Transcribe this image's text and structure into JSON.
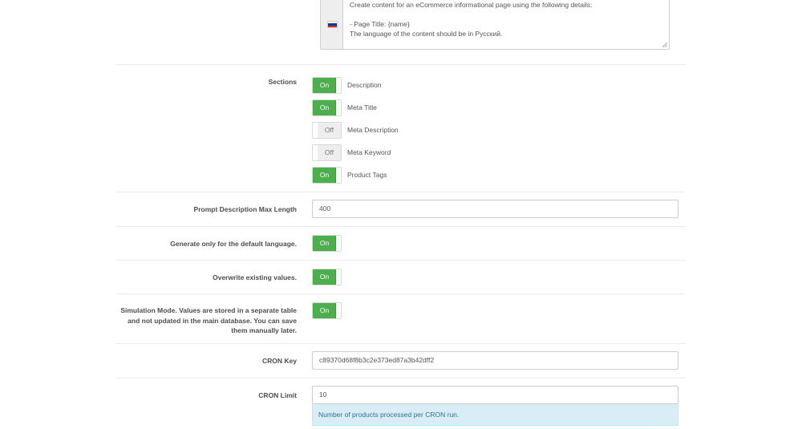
{
  "prompt": {
    "text": "Create content for an eCommerce informational page using the following details:\n\n- Page Title: {name}\nThe language of the content should be in Русский.",
    "flag_icon": "russia-flag-icon",
    "flag_colors": [
      "#ffffff",
      "#0039a6",
      "#d52b1e"
    ]
  },
  "sections": {
    "label": "Sections",
    "items": [
      {
        "label": "Description",
        "state": "On"
      },
      {
        "label": "Meta Title",
        "state": "On"
      },
      {
        "label": "Meta Description",
        "state": "Off"
      },
      {
        "label": "Meta Keyword",
        "state": "Off"
      },
      {
        "label": "Product Tags",
        "state": "On"
      }
    ]
  },
  "prompt_max_length": {
    "label": "Prompt Description Max Length",
    "value": "400"
  },
  "default_language_only": {
    "label": "Generate only for the default language.",
    "state": "On"
  },
  "overwrite": {
    "label": "Overwrite existing values.",
    "state": "On"
  },
  "simulation": {
    "label": "Simulation Mode. Values are stored in a separate table and not updated in the main database. You can save them manually later.",
    "state": "On"
  },
  "cron_key": {
    "label": "CRON Key",
    "value": "c89370d68f8b3c2e373ed87a3b42dff2"
  },
  "cron_limit": {
    "label": "CRON Limit",
    "value": "10",
    "help": "Number of products processed per CRON run."
  },
  "colors": {
    "on": "#4cae4c",
    "off": "#eeeeee",
    "help_bg": "#d9edf7",
    "help_text": "#31708f"
  }
}
